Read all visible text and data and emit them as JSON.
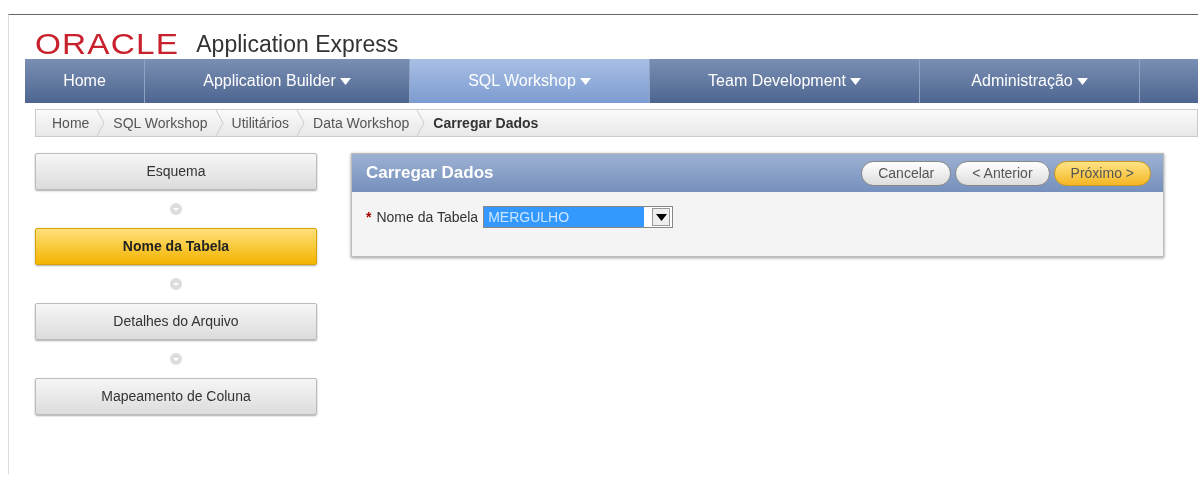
{
  "header": {
    "logo": "ORACLE",
    "product": "Application Express"
  },
  "tabs": [
    {
      "label": "Home",
      "selected": false,
      "has_menu": false
    },
    {
      "label": "Application Builder",
      "selected": false,
      "has_menu": true
    },
    {
      "label": "SQL Workshop",
      "selected": true,
      "has_menu": true
    },
    {
      "label": "Team Development",
      "selected": false,
      "has_menu": true
    },
    {
      "label": "Administração",
      "selected": false,
      "has_menu": true
    }
  ],
  "breadcrumb": [
    {
      "label": "Home",
      "current": false
    },
    {
      "label": "SQL Workshop",
      "current": false
    },
    {
      "label": "Utilitários",
      "current": false
    },
    {
      "label": "Data Workshop",
      "current": false
    },
    {
      "label": "Carregar Dados",
      "current": true
    }
  ],
  "wizard_steps": [
    {
      "label": "Esquema",
      "selected": false
    },
    {
      "label": "Nome da Tabela",
      "selected": true
    },
    {
      "label": "Detalhes do Arquivo",
      "selected": false
    },
    {
      "label": "Mapeamento de Coluna",
      "selected": false
    }
  ],
  "region": {
    "title": "Carregar Dados",
    "buttons": [
      {
        "label": "Cancelar",
        "kind": "plain"
      },
      {
        "label": "< Anterior",
        "kind": "plain"
      },
      {
        "label": "Próximo >",
        "kind": "hot"
      }
    ],
    "field": {
      "required_mark": "*",
      "label": "Nome da Tabela",
      "value": "MERGULHO"
    }
  }
}
